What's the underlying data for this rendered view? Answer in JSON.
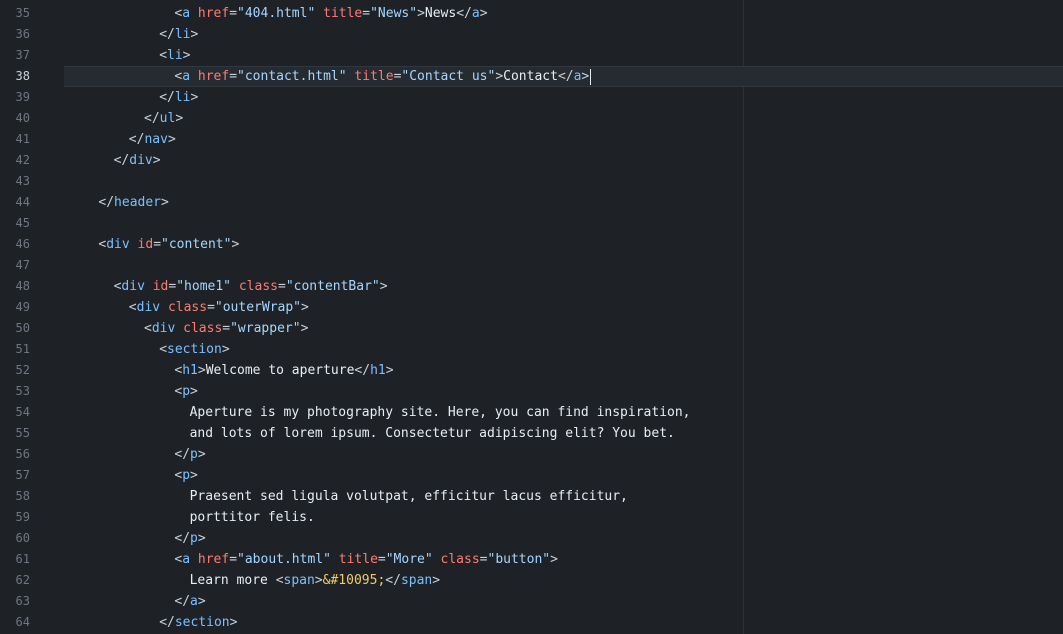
{
  "editor": {
    "active_line": 38,
    "lines": [
      {
        "n": "35",
        "indent": 14,
        "tokens": [
          [
            "br",
            "<"
          ],
          [
            "tagb",
            "a"
          ],
          [
            "br",
            " "
          ],
          [
            "attr",
            "href"
          ],
          [
            "br",
            "="
          ],
          [
            "str",
            "\"404.html\""
          ],
          [
            "br",
            " "
          ],
          [
            "attr",
            "title"
          ],
          [
            "br",
            "="
          ],
          [
            "str",
            "\"News\""
          ],
          [
            "br",
            ">"
          ],
          [
            "text",
            "News"
          ],
          [
            "br",
            "</"
          ],
          [
            "tagb",
            "a"
          ],
          [
            "br",
            ">"
          ]
        ]
      },
      {
        "n": "36",
        "indent": 12,
        "tokens": [
          [
            "br",
            "</"
          ],
          [
            "tagb",
            "li"
          ],
          [
            "br",
            ">"
          ]
        ]
      },
      {
        "n": "37",
        "indent": 12,
        "tokens": [
          [
            "br",
            "<"
          ],
          [
            "tagb",
            "li"
          ],
          [
            "br",
            ">"
          ]
        ]
      },
      {
        "n": "38",
        "indent": 14,
        "tokens": [
          [
            "br",
            "<"
          ],
          [
            "tagb",
            "a"
          ],
          [
            "br",
            " "
          ],
          [
            "attr",
            "href"
          ],
          [
            "br",
            "="
          ],
          [
            "str",
            "\"contact.html\""
          ],
          [
            "br",
            " "
          ],
          [
            "attr",
            "title"
          ],
          [
            "br",
            "="
          ],
          [
            "str",
            "\"Contact us\""
          ],
          [
            "br",
            ">"
          ],
          [
            "text",
            "Contact"
          ],
          [
            "br",
            "</"
          ],
          [
            "tagb",
            "a"
          ],
          [
            "br",
            ">"
          ]
        ]
      },
      {
        "n": "39",
        "indent": 12,
        "tokens": [
          [
            "br",
            "</"
          ],
          [
            "tagb",
            "li"
          ],
          [
            "br",
            ">"
          ]
        ]
      },
      {
        "n": "40",
        "indent": 10,
        "tokens": [
          [
            "br",
            "</"
          ],
          [
            "tagb",
            "ul"
          ],
          [
            "br",
            ">"
          ]
        ]
      },
      {
        "n": "41",
        "indent": 8,
        "tokens": [
          [
            "br",
            "</"
          ],
          [
            "tagb",
            "nav"
          ],
          [
            "br",
            ">"
          ]
        ]
      },
      {
        "n": "42",
        "indent": 6,
        "tokens": [
          [
            "br",
            "</"
          ],
          [
            "tagb",
            "div"
          ],
          [
            "br",
            ">"
          ]
        ]
      },
      {
        "n": "43",
        "indent": 0,
        "tokens": []
      },
      {
        "n": "44",
        "indent": 4,
        "tokens": [
          [
            "br",
            "</"
          ],
          [
            "tagb",
            "header"
          ],
          [
            "br",
            ">"
          ]
        ]
      },
      {
        "n": "45",
        "indent": 0,
        "tokens": []
      },
      {
        "n": "46",
        "indent": 4,
        "tokens": [
          [
            "br",
            "<"
          ],
          [
            "tagb",
            "div"
          ],
          [
            "br",
            " "
          ],
          [
            "attr",
            "id"
          ],
          [
            "br",
            "="
          ],
          [
            "str",
            "\"content\""
          ],
          [
            "br",
            ">"
          ]
        ]
      },
      {
        "n": "47",
        "indent": 0,
        "tokens": []
      },
      {
        "n": "48",
        "indent": 6,
        "tokens": [
          [
            "br",
            "<"
          ],
          [
            "tagb",
            "div"
          ],
          [
            "br",
            " "
          ],
          [
            "attr",
            "id"
          ],
          [
            "br",
            "="
          ],
          [
            "str",
            "\"home1\""
          ],
          [
            "br",
            " "
          ],
          [
            "attr",
            "class"
          ],
          [
            "br",
            "="
          ],
          [
            "str",
            "\"contentBar\""
          ],
          [
            "br",
            ">"
          ]
        ]
      },
      {
        "n": "49",
        "indent": 8,
        "tokens": [
          [
            "br",
            "<"
          ],
          [
            "tagb",
            "div"
          ],
          [
            "br",
            " "
          ],
          [
            "attr",
            "class"
          ],
          [
            "br",
            "="
          ],
          [
            "str",
            "\"outerWrap\""
          ],
          [
            "br",
            ">"
          ]
        ]
      },
      {
        "n": "50",
        "indent": 10,
        "tokens": [
          [
            "br",
            "<"
          ],
          [
            "tagb",
            "div"
          ],
          [
            "br",
            " "
          ],
          [
            "attr",
            "class"
          ],
          [
            "br",
            "="
          ],
          [
            "str",
            "\"wrapper\""
          ],
          [
            "br",
            ">"
          ]
        ]
      },
      {
        "n": "51",
        "indent": 12,
        "tokens": [
          [
            "br",
            "<"
          ],
          [
            "tagb",
            "section"
          ],
          [
            "br",
            ">"
          ]
        ]
      },
      {
        "n": "52",
        "indent": 14,
        "tokens": [
          [
            "br",
            "<"
          ],
          [
            "tagb",
            "h1"
          ],
          [
            "br",
            ">"
          ],
          [
            "text",
            "Welcome to aperture"
          ],
          [
            "br",
            "</"
          ],
          [
            "tagb",
            "h1"
          ],
          [
            "br",
            ">"
          ]
        ]
      },
      {
        "n": "53",
        "indent": 14,
        "tokens": [
          [
            "br",
            "<"
          ],
          [
            "tagb",
            "p"
          ],
          [
            "br",
            ">"
          ]
        ]
      },
      {
        "n": "54",
        "indent": 16,
        "tokens": [
          [
            "text",
            "Aperture is my photography site. Here, you can find inspiration,"
          ]
        ]
      },
      {
        "n": "55",
        "indent": 16,
        "tokens": [
          [
            "text",
            "and lots of lorem ipsum. Consectetur adipiscing elit? You bet."
          ]
        ]
      },
      {
        "n": "56",
        "indent": 14,
        "tokens": [
          [
            "br",
            "</"
          ],
          [
            "tagb",
            "p"
          ],
          [
            "br",
            ">"
          ]
        ]
      },
      {
        "n": "57",
        "indent": 14,
        "tokens": [
          [
            "br",
            "<"
          ],
          [
            "tagb",
            "p"
          ],
          [
            "br",
            ">"
          ]
        ]
      },
      {
        "n": "58",
        "indent": 16,
        "tokens": [
          [
            "text",
            "Praesent sed ligula volutpat, efficitur lacus efficitur,"
          ]
        ]
      },
      {
        "n": "59",
        "indent": 16,
        "tokens": [
          [
            "text",
            "porttitor felis."
          ]
        ]
      },
      {
        "n": "60",
        "indent": 14,
        "tokens": [
          [
            "br",
            "</"
          ],
          [
            "tagb",
            "p"
          ],
          [
            "br",
            ">"
          ]
        ]
      },
      {
        "n": "61",
        "indent": 14,
        "tokens": [
          [
            "br",
            "<"
          ],
          [
            "tagb",
            "a"
          ],
          [
            "br",
            " "
          ],
          [
            "attr",
            "href"
          ],
          [
            "br",
            "="
          ],
          [
            "str",
            "\"about.html\""
          ],
          [
            "br",
            " "
          ],
          [
            "attr",
            "title"
          ],
          [
            "br",
            "="
          ],
          [
            "str",
            "\"More\""
          ],
          [
            "br",
            " "
          ],
          [
            "attr",
            "class"
          ],
          [
            "br",
            "="
          ],
          [
            "str",
            "\"button\""
          ],
          [
            "br",
            ">"
          ]
        ]
      },
      {
        "n": "62",
        "indent": 16,
        "tokens": [
          [
            "text",
            "Learn more "
          ],
          [
            "br",
            "<"
          ],
          [
            "tagb",
            "span"
          ],
          [
            "br",
            ">"
          ],
          [
            "ent",
            "&#10095;"
          ],
          [
            "br",
            "</"
          ],
          [
            "tagb",
            "span"
          ],
          [
            "br",
            ">"
          ]
        ]
      },
      {
        "n": "63",
        "indent": 14,
        "tokens": [
          [
            "br",
            "</"
          ],
          [
            "tagb",
            "a"
          ],
          [
            "br",
            ">"
          ]
        ]
      },
      {
        "n": "64",
        "indent": 12,
        "tokens": [
          [
            "br",
            "</"
          ],
          [
            "tagb",
            "section"
          ],
          [
            "br",
            ">"
          ]
        ]
      }
    ]
  },
  "colors": {
    "background": "#1e2227",
    "line_number": "#6e7681",
    "tag": "#79c0ff",
    "attribute": "#ff7b72",
    "string": "#a5d6ff",
    "text": "#e6edf3",
    "entity": "#f2cc60"
  }
}
